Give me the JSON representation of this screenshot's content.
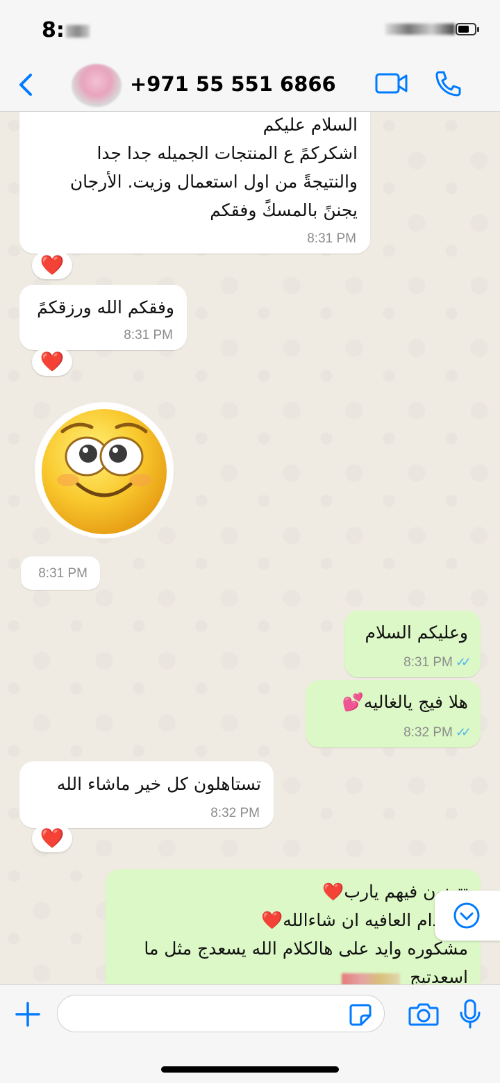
{
  "status_bar": {
    "time": "8:"
  },
  "header": {
    "contact_name": "+971 55 551 6866",
    "icons": [
      "back-chevron-icon",
      "video-call-icon",
      "phone-call-icon"
    ]
  },
  "messages": [
    {
      "direction": "incoming",
      "text": "السلام عليكم\nاشكركمً ع المنتجات الجميله جدا جدا\nوالنتيجةً من اول استعمال وزيت. الأرجان\nيجننً بالمسكً وفقكم",
      "time": "8:31 PM",
      "reaction": "❤️"
    },
    {
      "direction": "incoming",
      "text": "وفقكم الله ورزقكمً",
      "time": "8:31 PM",
      "reaction": "❤️"
    },
    {
      "direction": "incoming",
      "type": "sticker",
      "sticker": "smiling-face-emoji",
      "time": "8:31 PM"
    },
    {
      "direction": "outgoing",
      "text": "وعليكم السلام",
      "time": "8:31 PM",
      "status": "read"
    },
    {
      "direction": "outgoing",
      "text": "هلا فيج يالغاليه💕",
      "time": "8:32 PM",
      "status": "read"
    },
    {
      "direction": "incoming",
      "text": "تستاهلون كل خير ماشاء الله",
      "time": "8:32 PM",
      "reaction": "❤️"
    },
    {
      "direction": "outgoing",
      "text": "تتهنون فيهم يارب❤️\nبالخدام العافيه ان شاءالله❤️\nمشكوره وايد على هالكلام الله يسعدج مثل ما\nاسعدتيج"
    }
  ],
  "composer": {
    "placeholder": "",
    "value": ""
  },
  "colors": {
    "accent": "#007aff",
    "outgoing_bubble": "#dcf8c6",
    "incoming_bubble": "#ffffff",
    "read_ticks": "#4fb6ec",
    "heart": "#e0203a"
  }
}
